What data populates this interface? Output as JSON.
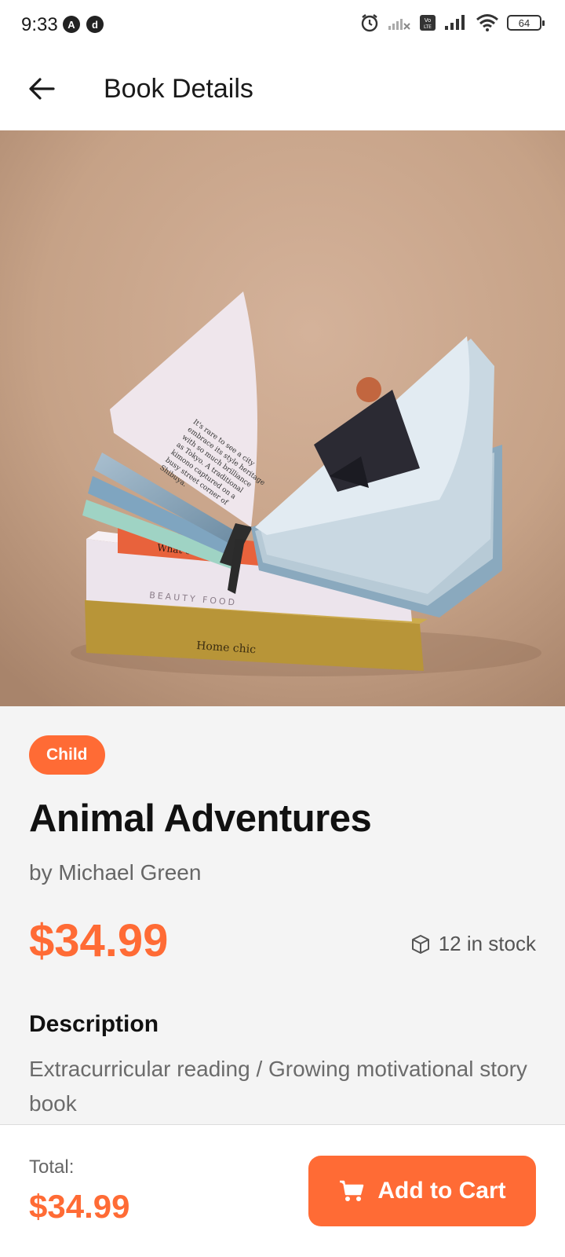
{
  "status_bar": {
    "time": "9:33",
    "left_icons": [
      "A",
      "d"
    ],
    "battery": "64"
  },
  "app_bar": {
    "title": "Book Details",
    "back_icon": "arrow-left-icon"
  },
  "book": {
    "category": "Child",
    "title": "Animal Adventures",
    "author": "by Michael Green",
    "price": "$34.99",
    "stock": "12 in stock",
    "description_heading": "Description",
    "description": "Extracurricular reading / Growing motivational story book"
  },
  "footer": {
    "total_label": "Total:",
    "total_value": "$34.99",
    "add_to_cart_label": "Add to Cart",
    "cart_icon": "cart-icon"
  },
  "colors": {
    "accent": "#ff6b35",
    "background": "#f4f4f4",
    "hero_bg": "#c8a58a"
  }
}
